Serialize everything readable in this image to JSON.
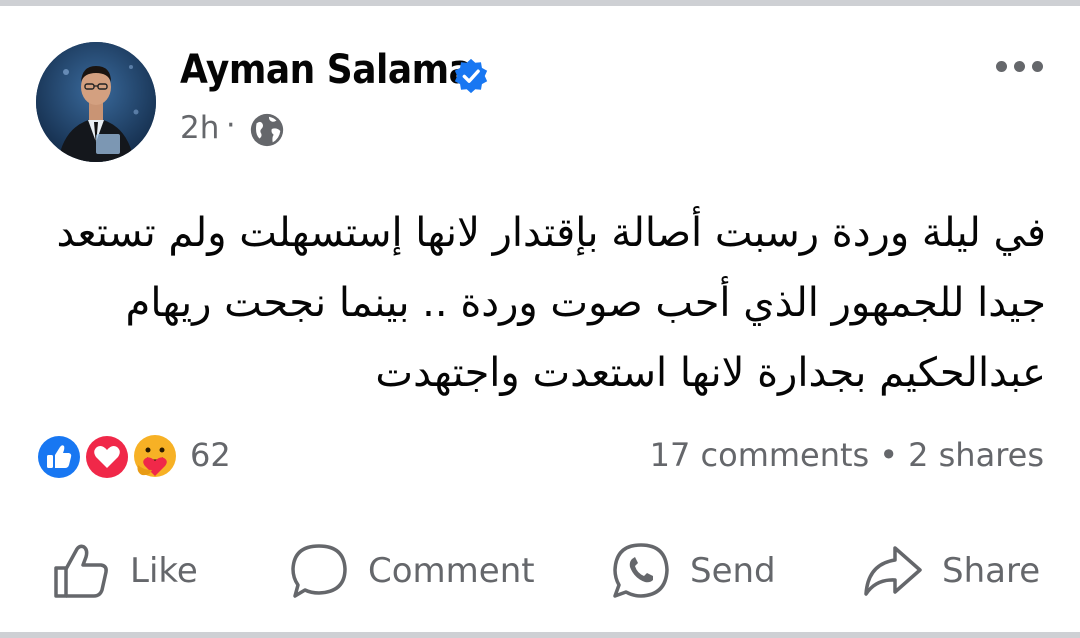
{
  "post": {
    "author": "Ayman Salama",
    "time": "2h",
    "separator": "·",
    "text_lines": [
      "في ليلة وردة رسبت أصالة بإقتدار لانها إستسهلت ولم تستعد",
      "جيدا للجمهور الذي أحب صوت وردة .. بينما نجحت ريهام",
      "عبدالحكيم بجدارة لانها استعدت واجتهدت"
    ],
    "icons": {
      "verified": "verified-badge-icon",
      "privacy": "globe-icon",
      "more": "more-options-icon"
    }
  },
  "reactions": {
    "count": "62",
    "types": [
      "like",
      "love",
      "care"
    ]
  },
  "stats": {
    "comments": "17 comments",
    "separator": "•",
    "shares": "2 shares"
  },
  "actions": {
    "like": "Like",
    "comment": "Comment",
    "send": "Send",
    "share": "Share"
  },
  "colors": {
    "accent": "#1877f2",
    "text": "#050505",
    "secondary_text": "#65676b",
    "like_blue": "#1877f2",
    "love_red": "#f02849",
    "care_yellow": "#f7b125"
  }
}
